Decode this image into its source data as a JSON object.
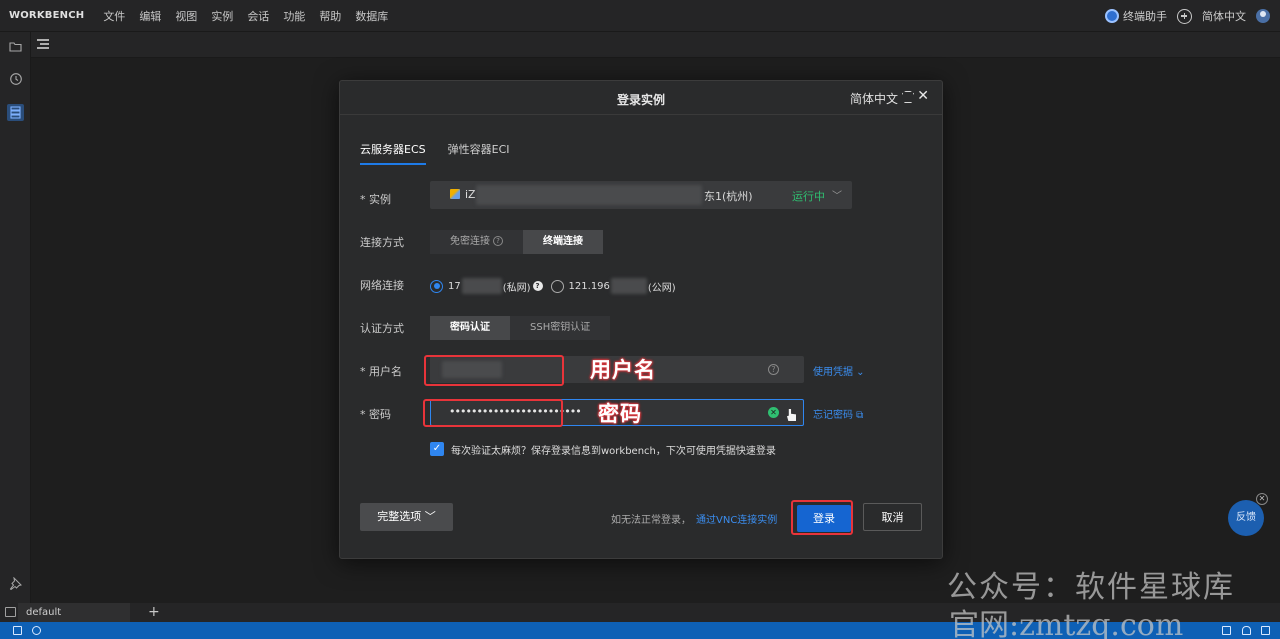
{
  "menubar": {
    "brand": "WORKBENCH",
    "items": [
      "文件",
      "编辑",
      "视图",
      "实例",
      "会话",
      "功能",
      "帮助",
      "数据库"
    ],
    "assistant": "终端助手",
    "language": "简体中文"
  },
  "bottom_tab": {
    "label": "default"
  },
  "dialog": {
    "title": "登录实例",
    "language": "简体中文",
    "tabs": [
      "云服务器ECS",
      "弹性容器ECI"
    ],
    "instance": {
      "label": "实例",
      "name_prefix": "iZ",
      "region_suffix": "东1(杭州)",
      "status": "运行中"
    },
    "connect_method": {
      "label": "连接方式",
      "options": [
        "免密连接",
        "终端连接"
      ],
      "selected": "终端连接"
    },
    "network": {
      "label": "网络连接",
      "private_prefix": "17",
      "private_suffix": "(私网)",
      "public_prefix": "121.196",
      "public_suffix": "(公网)"
    },
    "auth": {
      "label": "认证方式",
      "options": [
        "密码认证",
        "SSH密钥认证"
      ],
      "selected": "密码认证"
    },
    "username": {
      "label": "用户名",
      "link": "使用凭据"
    },
    "password": {
      "label": "密码",
      "value": "••••••••••••••••••••••••",
      "link": "忘记密码"
    },
    "remember": {
      "checked": true,
      "text": "每次验证太麻烦？保存登录信息到workbench，下次可使用凭据快速登录"
    },
    "footer": {
      "options_button": "完整选项",
      "note": "如无法正常登录，",
      "vnc_link": "通过VNC连接实例",
      "login_button": "登录",
      "cancel_button": "取消"
    }
  },
  "annotations": {
    "username": "用户名",
    "password": "密码"
  },
  "feedback": "反馈",
  "watermark": {
    "line1": "公众号：软件星球库",
    "line2": "官网:zmtzq.com"
  },
  "colors": {
    "accent": "#1565d1",
    "running": "#2fbf71",
    "annotation": "#e8343a"
  }
}
